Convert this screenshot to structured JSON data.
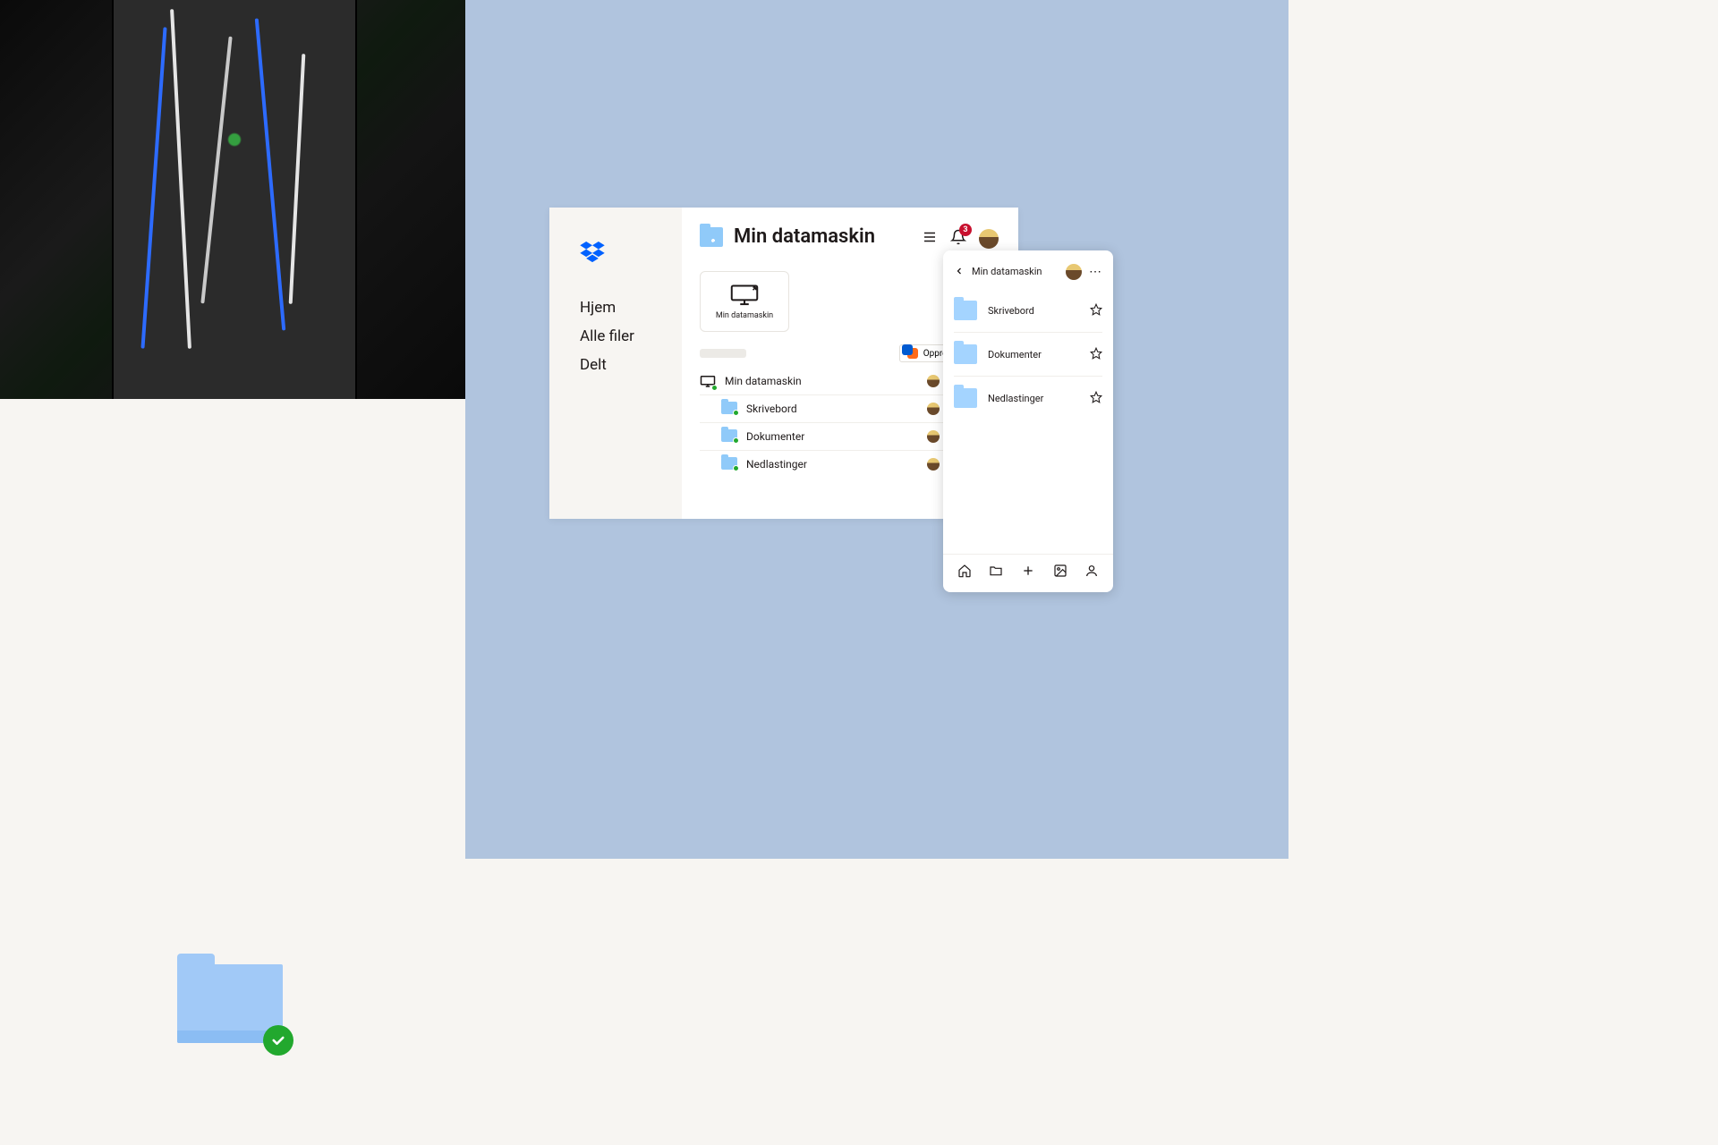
{
  "desktop": {
    "title": "Min datamaskin",
    "nav": {
      "home": "Hjem",
      "all_files": "Alle filer",
      "shared": "Delt"
    },
    "notif_count": "3",
    "card_label": "Min datamaskin",
    "create_label": "Opprett",
    "rows": [
      {
        "name": "Min datamaskin",
        "icon": "computer"
      },
      {
        "name": "Skrivebord",
        "icon": "folder"
      },
      {
        "name": "Dokumenter",
        "icon": "folder"
      },
      {
        "name": "Nedlastinger",
        "icon": "folder"
      }
    ]
  },
  "mobile": {
    "title": "Min datamaskin",
    "items": [
      {
        "name": "Skrivebord"
      },
      {
        "name": "Dokumenter"
      },
      {
        "name": "Nedlastinger"
      }
    ]
  }
}
